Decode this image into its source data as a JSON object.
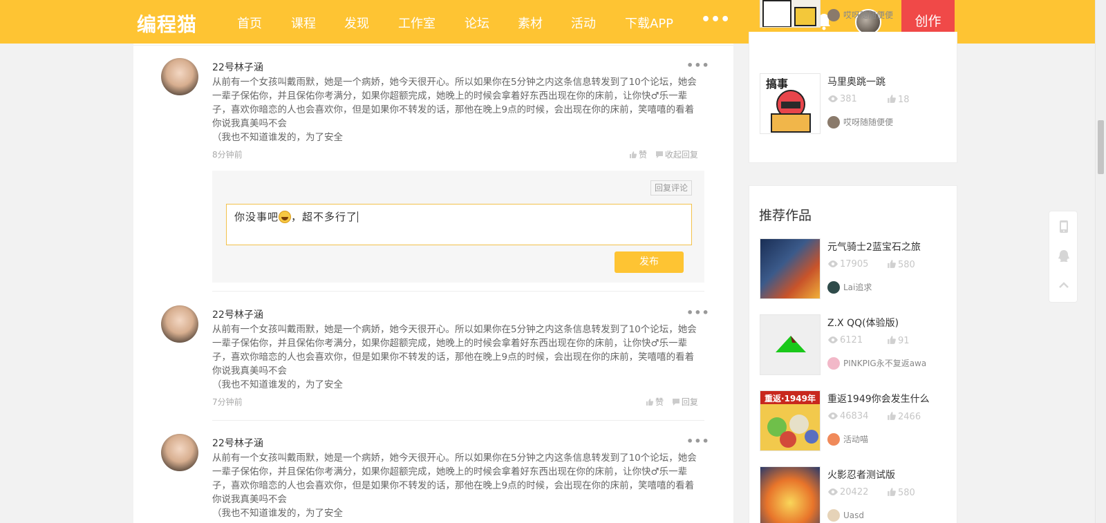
{
  "header": {
    "logo": "编程猫",
    "nav": [
      "首页",
      "课程",
      "发现",
      "工作室",
      "论坛",
      "素材",
      "活动",
      "下载APP"
    ],
    "more": "•••",
    "create": "创作"
  },
  "comments": [
    {
      "name": "22号林子涵",
      "text": "从前有一个女孩叫戴雨默，她是一个病娇，她今天很开心。所以如果你在5分钟之内这条信息转发到了10个论坛，她会一辈子保佑你，并且保佑你考满分，如果你超额完成，她晚上的时候会拿着好东西出现在你的床前，让你快♂乐一辈子，喜欢你暗恋的人也会喜欢你，但是如果你不转发的话，那他在晚上9点的时候，会出现在你的床前，笑嘻嘻的看着你说我真美吗不会",
      "text2": "（我也不知道谁发的，为了安全",
      "time": "8分钟前",
      "like": "赞",
      "reply": "收起回复"
    },
    {
      "name": "22号林子涵",
      "text": "从前有一个女孩叫戴雨默，她是一个病娇，她今天很开心。所以如果你在5分钟之内这条信息转发到了10个论坛，她会一辈子保佑你，并且保佑你考满分，如果你超额完成，她晚上的时候会拿着好东西出现在你的床前，让你快♂乐一辈子，喜欢你暗恋的人也会喜欢你，但是如果你不转发的话，那他在晚上9点的时候，会出现在你的床前，笑嘻嘻的看着你说我真美吗不会",
      "text2": "（我也不知道谁发的，为了安全",
      "time": "7分钟前",
      "like": "赞",
      "reply": "回复"
    },
    {
      "name": "22号林子涵",
      "text": "从前有一个女孩叫戴雨默，她是一个病娇，她今天很开心。所以如果你在5分钟之内这条信息转发到了10个论坛，她会一辈子保佑你，并且保佑你考满分，如果你超额完成，她晚上的时候会拿着好东西出现在你的床前，让你快♂乐一辈子，喜欢你暗恋的人也会喜欢你，但是如果你不转发的话，那他在晚上9点的时候，会出现在你的床前，笑嘻嘻的看着你说我真美吗不会",
      "text2": "（我也不知道谁发的，为了安全"
    }
  ],
  "reply_box": {
    "tag": "回复评论",
    "input_before": "你没事吧",
    "input_after": "，超不多行了",
    "publish": "发布"
  },
  "related": [
    {
      "author": "哎呀随随便便"
    },
    {
      "title": "马里奥跳一跳",
      "views": "381",
      "likes": "18",
      "author": "哎呀随随便便"
    }
  ],
  "recommend": {
    "title": "推荐作品",
    "works": [
      {
        "title": "元气骑士2蓝宝石之旅",
        "views": "17905",
        "likes": "580",
        "author": "Lai追求"
      },
      {
        "title": "Z.X QQ(体验版)",
        "views": "6121",
        "likes": "91",
        "author": "PINKPIG永不复返awa"
      },
      {
        "title": "重返1949你会发生什么",
        "views": "46834",
        "likes": "2466",
        "author": "活动喵"
      },
      {
        "title": "火影忍者测试版",
        "views": "20422",
        "likes": "580",
        "author": "Uasd"
      }
    ]
  },
  "colors": {
    "brand": "#fec433",
    "create": "#f04948"
  }
}
